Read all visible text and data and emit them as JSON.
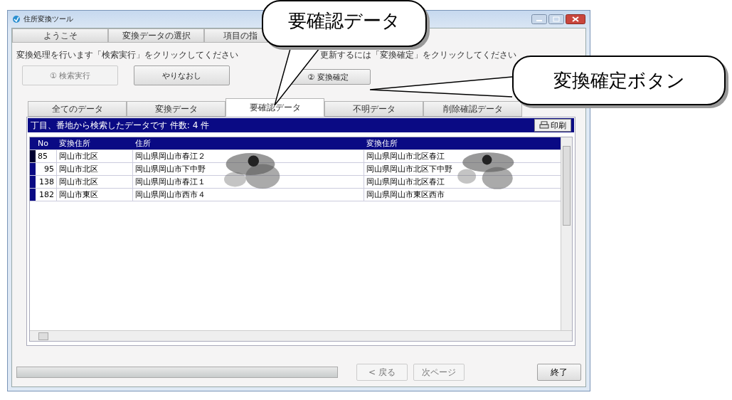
{
  "window": {
    "title": "住所変換ツール"
  },
  "main_tabs": [
    {
      "label": "ようこそ",
      "selected": false
    },
    {
      "label": "変換データの選択",
      "selected": false
    },
    {
      "label": "項目の指",
      "selected": false
    }
  ],
  "instructions": [
    {
      "text": "変換処理を行います「検索実行」をクリックしてください"
    },
    {
      "text": "更新するには「変換確定」をクリックしてください"
    }
  ],
  "action_buttons": [
    {
      "label": "① 検索実行",
      "disabled": true
    },
    {
      "label": "やりなおし",
      "disabled": false
    },
    {
      "label": "② 変換確定",
      "disabled": false
    }
  ],
  "data_tabs": [
    {
      "label": "全てのデータ",
      "selected": false
    },
    {
      "label": "変換データ",
      "selected": false
    },
    {
      "label": "要確認データ",
      "selected": true
    },
    {
      "label": "不明データ",
      "selected": false
    },
    {
      "label": "削除確認データ",
      "selected": false
    }
  ],
  "result_header": {
    "text": "丁目、番地から検索したデータです 件数: 4 件",
    "print_button": "印刷"
  },
  "table": {
    "columns": [
      "No",
      "変換住所",
      "住所",
      "変換住所"
    ],
    "rows": [
      {
        "cells": [
          "85",
          "岡山市北区",
          "岡山県岡山市春江２",
          "岡山県岡山市北区春江"
        ],
        "selected": true
      },
      {
        "cells": [
          "95",
          "岡山市北区",
          "岡山県岡山市下中野",
          "岡山県岡山市北区下中野"
        ],
        "selected": false
      },
      {
        "cells": [
          "138",
          "岡山市北区",
          "岡山県岡山市春江１",
          "岡山県岡山市北区春江"
        ],
        "selected": false
      },
      {
        "cells": [
          "182",
          "岡山市東区",
          "岡山県岡山市西市４",
          "岡山県岡山市東区西市"
        ],
        "selected": false
      }
    ]
  },
  "progress": {
    "level": 1
  },
  "footer_buttons": [
    {
      "label": "< 戻る",
      "disabled": true
    },
    {
      "label": "次ページ",
      "disabled": true
    },
    {
      "label": "終了",
      "disabled": false
    }
  ],
  "callouts": [
    {
      "text": "要確認データ"
    },
    {
      "text": "変換確定ボタン"
    }
  ]
}
